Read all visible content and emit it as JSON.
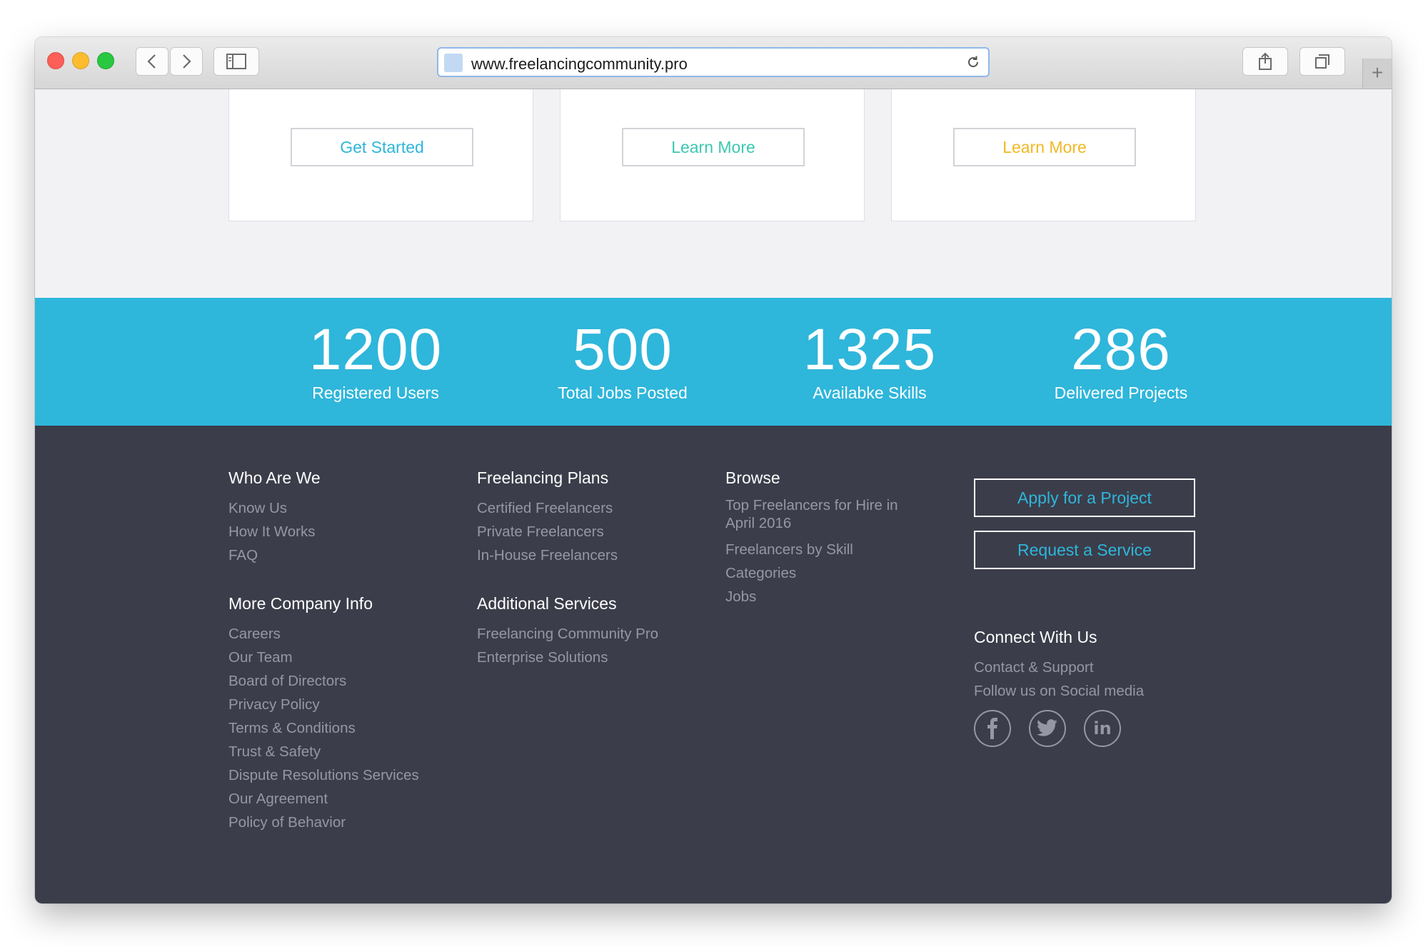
{
  "browser": {
    "url": "www.freelancingcommunity.pro"
  },
  "cards": [
    {
      "button_label": "Get Started",
      "button_color": "#2fb6db"
    },
    {
      "button_label": "Learn More",
      "button_color": "#3cc7b2"
    },
    {
      "button_label": "Learn More",
      "button_color": "#f2b824"
    }
  ],
  "stats": [
    {
      "value": "1200",
      "label": "Registered Users"
    },
    {
      "value": "500",
      "label": "Total Jobs Posted"
    },
    {
      "value": "1325",
      "label": "Availabke Skills"
    },
    {
      "value": "286",
      "label": "Delivered Projects"
    }
  ],
  "footer": {
    "who_are_we": {
      "heading": "Who Are We",
      "links": [
        "Know Us",
        "How It Works",
        "FAQ"
      ]
    },
    "more_company_info": {
      "heading": "More Company Info",
      "links": [
        "Careers",
        "Our Team",
        "Board of Directors",
        "Privacy Policy",
        "Terms & Conditions",
        "Trust & Safety",
        "Dispute Resolutions Services",
        "Our Agreement",
        "Policy of Behavior"
      ]
    },
    "freelancing_plans": {
      "heading": "Freelancing Plans",
      "links": [
        "Certified Freelancers",
        "Private Freelancers",
        "In-House Freelancers"
      ]
    },
    "additional_services": {
      "heading": "Additional Services",
      "links": [
        "Freelancing Community Pro",
        "Enterprise Solutions"
      ]
    },
    "browse": {
      "heading": "Browse",
      "links": [
        "Top Freelancers for Hire in April 2016",
        "Freelancers by Skill",
        "Categories",
        "Jobs"
      ]
    },
    "cta": {
      "apply_label": "Apply for a Project",
      "request_label": "Request a Service"
    },
    "connect": {
      "heading": "Connect With Us",
      "links": [
        "Contact & Support",
        "Follow us on Social media"
      ],
      "social_icons": [
        "facebook-icon",
        "twitter-icon",
        "linkedin-icon"
      ]
    }
  },
  "colors": {
    "accent": "#2fb6db",
    "footer_bg": "#3b3d4a",
    "page_bg": "#f2f2f5"
  }
}
